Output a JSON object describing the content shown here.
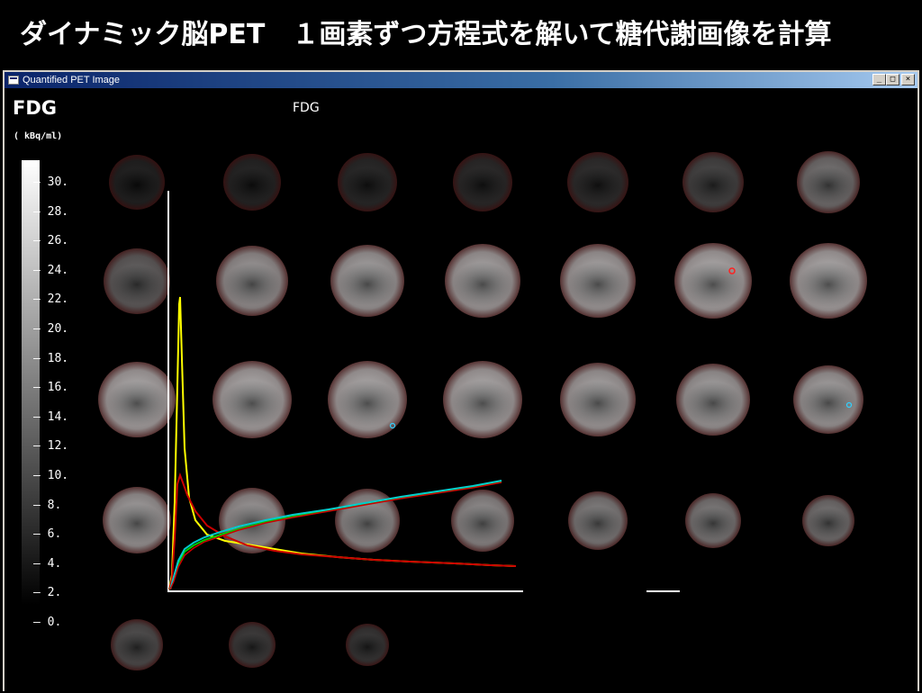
{
  "slide": {
    "title": "ダイナミック脳PET　１画素ずつ方程式を解いて糖代謝画像を計算"
  },
  "window": {
    "title": "Quantified PET Image",
    "buttons": [
      "minimize",
      "maximize",
      "close"
    ]
  },
  "viewer": {
    "tracer": "FDG",
    "units": "( kBq/ml)",
    "image_title": "FDG",
    "colormap": "grayscale",
    "scale_ticks": [
      "30.",
      "28.",
      "26.",
      "24.",
      "22.",
      "20.",
      "18.",
      "16.",
      "14.",
      "12.",
      "10.",
      "8.",
      "6.",
      "4.",
      "2.",
      "0."
    ],
    "slice_rows": 5,
    "slice_cols": 7,
    "visible_slices": 31
  },
  "curve_overlay": {
    "series_colors": [
      "#ffff00",
      "#cc0000",
      "#00cc00",
      "#00cccc",
      "#ffcc00"
    ]
  },
  "colors": {
    "background": "#000000",
    "titlebar": "#0a246a",
    "curve_axes": "#ffffff"
  }
}
